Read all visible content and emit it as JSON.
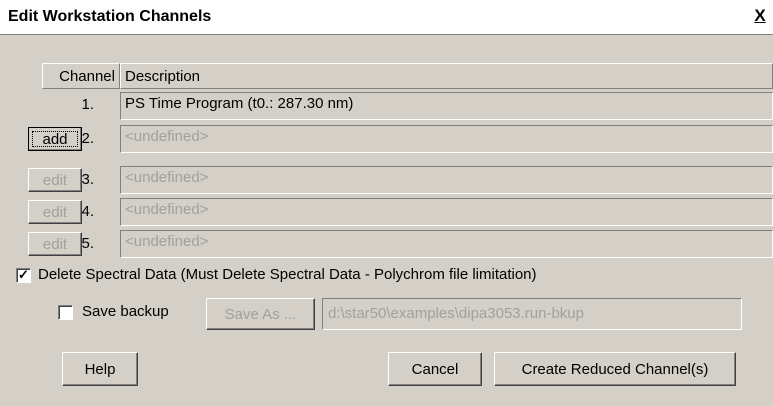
{
  "window": {
    "title": "Edit Workstation Channels",
    "close_label": "X"
  },
  "table": {
    "headers": {
      "channel": "Channel",
      "description": "Description"
    },
    "rows": [
      {
        "number": "1.",
        "button": "",
        "description": "PS Time Program  (t0.: 287.30 nm)",
        "button_enabled": false,
        "description_enabled": true
      },
      {
        "number": "2.",
        "button": "add",
        "description": "<undefined>",
        "button_enabled": true,
        "description_enabled": false
      },
      {
        "number": "3.",
        "button": "edit",
        "description": "<undefined>",
        "button_enabled": false,
        "description_enabled": false
      },
      {
        "number": "4.",
        "button": "edit",
        "description": "<undefined>",
        "button_enabled": false,
        "description_enabled": false
      },
      {
        "number": "5.",
        "button": "edit",
        "description": "<undefined>",
        "button_enabled": false,
        "description_enabled": false
      }
    ]
  },
  "options": {
    "delete_spectral": {
      "label": "Delete Spectral Data (Must Delete Spectral Data - Polychrom file limitation)",
      "checked": true
    },
    "save_backup": {
      "label": "Save backup",
      "checked": false
    },
    "save_as_label": "Save As ...",
    "backup_path": "d:\\star50\\examples\\dipa3053.run-bkup"
  },
  "buttons": {
    "help": "Help",
    "cancel": "Cancel",
    "create": "Create Reduced Channel(s)"
  }
}
